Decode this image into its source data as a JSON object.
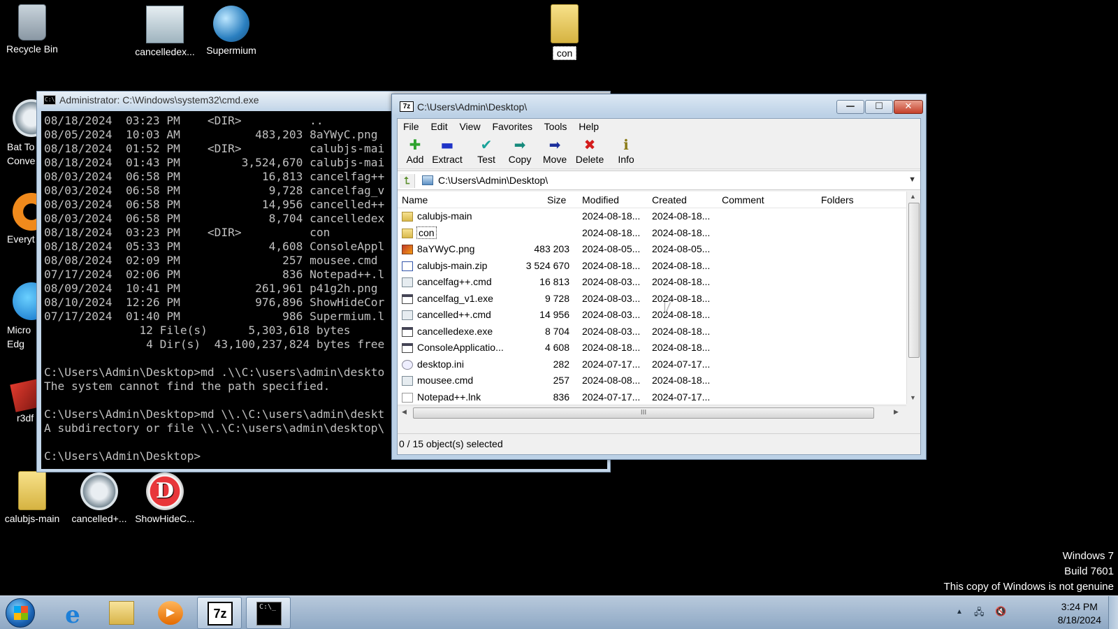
{
  "desktop": {
    "icons": [
      {
        "label": "Recycle Bin",
        "icon": "recycle-bin-icon"
      },
      {
        "label": "cancelledex...",
        "icon": "application-icon"
      },
      {
        "label": "Supermium",
        "icon": "globe-icon"
      },
      {
        "label": "con",
        "icon": "folder-icon"
      },
      {
        "label": "Bat To Conve",
        "icon": "gear-icon"
      },
      {
        "label": "Everyt",
        "icon": "search-icon"
      },
      {
        "label": "Micro Edg",
        "icon": "edge-icon"
      },
      {
        "label": "r3df",
        "icon": "r3df-icon"
      },
      {
        "label": "calubjs-main",
        "icon": "folder-icon"
      },
      {
        "label": "cancelled+...",
        "icon": "gear-icon"
      },
      {
        "label": "ShowHideC...",
        "icon": "d-icon",
        "glyph": "D"
      }
    ]
  },
  "watermark": {
    "line1": "Windows 7",
    "line2": "Build 7601",
    "line3": "This copy of Windows is not genuine"
  },
  "cmd": {
    "title": "Administrator: C:\\Windows\\system32\\cmd.exe",
    "icon_text": "C:\\",
    "lines": [
      "08/18/2024  03:23 PM    <DIR>          ..",
      "08/05/2024  10:03 AM           483,203 8aYWyC.png",
      "08/18/2024  01:52 PM    <DIR>          calubjs-mai",
      "08/18/2024  01:43 PM         3,524,670 calubjs-mai",
      "08/03/2024  06:58 PM            16,813 cancelfag++",
      "08/03/2024  06:58 PM             9,728 cancelfag_v",
      "08/03/2024  06:58 PM            14,956 cancelled++",
      "08/03/2024  06:58 PM             8,704 cancelledex",
      "08/18/2024  03:23 PM    <DIR>          con",
      "08/18/2024  05:33 PM             4,608 ConsoleAppl",
      "08/08/2024  02:09 PM               257 mousee.cmd",
      "07/17/2024  02:06 PM               836 Notepad++.l",
      "08/09/2024  10:41 PM           261,961 p41g2h.png",
      "08/10/2024  12:26 PM           976,896 ShowHideCor",
      "07/17/2024  01:40 PM               986 Supermium.l",
      "              12 File(s)      5,303,618 bytes",
      "               4 Dir(s)  43,100,237,824 bytes free",
      "",
      "C:\\Users\\Admin\\Desktop>md .\\\\C:\\users\\admin\\deskto",
      "The system cannot find the path specified.",
      "",
      "C:\\Users\\Admin\\Desktop>md \\\\.\\C:\\users\\admin\\deskt",
      "A subdirectory or file \\\\.\\C:\\users\\admin\\desktop\\",
      "",
      "C:\\Users\\Admin\\Desktop>"
    ]
  },
  "zip": {
    "app_icon": "7z",
    "title": "C:\\Users\\Admin\\Desktop\\",
    "menu": [
      "File",
      "Edit",
      "View",
      "Favorites",
      "Tools",
      "Help"
    ],
    "toolbar": [
      {
        "label": "Add",
        "icon": "add-icon",
        "glyph": "✚",
        "color": "#2ea32e"
      },
      {
        "label": "Extract",
        "icon": "extract-icon",
        "glyph": "▬",
        "color": "#1f33c7"
      },
      {
        "label": "Test",
        "icon": "test-icon",
        "glyph": "✔",
        "color": "#1aa39a"
      },
      {
        "label": "Copy",
        "icon": "copy-icon",
        "glyph": "➡",
        "color": "#168a7c"
      },
      {
        "label": "Move",
        "icon": "move-icon",
        "glyph": "➡",
        "color": "#1b2f9c"
      },
      {
        "label": "Delete",
        "icon": "delete-icon",
        "glyph": "✖",
        "color": "#d41c1c"
      },
      {
        "label": "Info",
        "icon": "info-icon",
        "glyph": "ℹ",
        "color": "#8a7a16"
      }
    ],
    "address": "C:\\Users\\Admin\\Desktop\\",
    "columns": {
      "name": "Name",
      "size": "Size",
      "modified": "Modified",
      "created": "Created",
      "comment": "Comment",
      "folders": "Folders"
    },
    "files": [
      {
        "name": "calubjs-main",
        "size": "",
        "modified": "2024-08-18...",
        "created": "2024-08-18...",
        "type": "folder"
      },
      {
        "name": "con",
        "size": "",
        "modified": "2024-08-18...",
        "created": "2024-08-18...",
        "type": "folder"
      },
      {
        "name": "8aYWyC.png",
        "size": "483 203",
        "modified": "2024-08-05...",
        "created": "2024-08-05...",
        "type": "img"
      },
      {
        "name": "calubjs-main.zip",
        "size": "3 524 670",
        "modified": "2024-08-18...",
        "created": "2024-08-18...",
        "type": "zip"
      },
      {
        "name": "cancelfag++.cmd",
        "size": "16 813",
        "modified": "2024-08-03...",
        "created": "2024-08-18...",
        "type": "cmd"
      },
      {
        "name": "cancelfag_v1.exe",
        "size": "9 728",
        "modified": "2024-08-03...",
        "created": "2024-08-18...",
        "type": "exe"
      },
      {
        "name": "cancelled++.cmd",
        "size": "14 956",
        "modified": "2024-08-03...",
        "created": "2024-08-18...",
        "type": "cmd"
      },
      {
        "name": "cancelledexe.exe",
        "size": "8 704",
        "modified": "2024-08-03...",
        "created": "2024-08-18...",
        "type": "exe"
      },
      {
        "name": "ConsoleApplicatio...",
        "size": "4 608",
        "modified": "2024-08-18...",
        "created": "2024-08-18...",
        "type": "exe"
      },
      {
        "name": "desktop.ini",
        "size": "282",
        "modified": "2024-07-17...",
        "created": "2024-07-17...",
        "type": "ini"
      },
      {
        "name": "mousee.cmd",
        "size": "257",
        "modified": "2024-08-08...",
        "created": "2024-08-18...",
        "type": "cmd"
      },
      {
        "name": "Notepad++.lnk",
        "size": "836",
        "modified": "2024-07-17...",
        "created": "2024-07-17...",
        "type": "lnk"
      }
    ],
    "status": "0 / 15 object(s) selected"
  },
  "taskbar": {
    "items": [
      {
        "icon": "internet-explorer-icon",
        "glyph": "e"
      },
      {
        "icon": "file-explorer-icon",
        "glyph": ""
      },
      {
        "icon": "media-player-icon",
        "glyph": "▶"
      },
      {
        "icon": "7zip-icon",
        "glyph": "7z"
      },
      {
        "icon": "cmd-icon",
        "glyph": "C:\\_"
      }
    ],
    "tray_up": "▲",
    "tray_network": "🖧",
    "tray_volume": "🔇",
    "time": "3:24 PM",
    "date": "8/18/2024"
  }
}
